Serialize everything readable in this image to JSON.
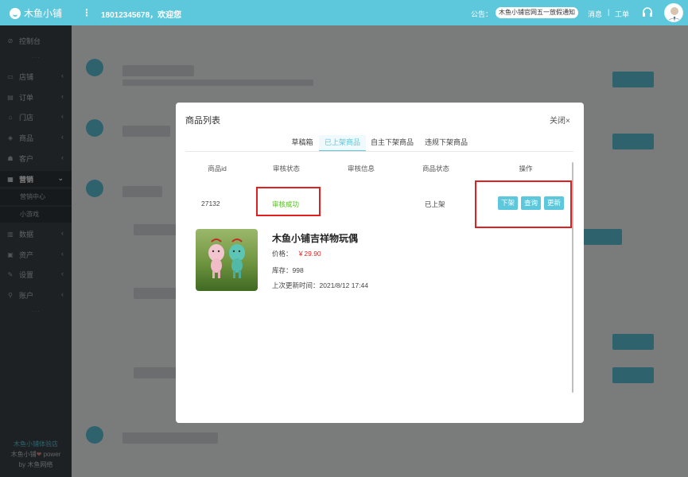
{
  "header": {
    "logo_text": "木鱼小铺",
    "more_icon": "⋮",
    "welcome": "18012345678，欢迎您",
    "notice_label": "公告：",
    "notice_text": "木鱼小铺官网五一放假通知",
    "messages": "消息",
    "separator": "|",
    "tickets": "工单",
    "colors": {
      "accent": "#5dc7dc"
    }
  },
  "sidebar": {
    "items": [
      {
        "label": "控制台",
        "icon": "dashboard-icon"
      },
      {
        "label": "店铺",
        "icon": "shop-icon"
      },
      {
        "label": "订单",
        "icon": "order-icon"
      },
      {
        "label": "门店",
        "icon": "store-icon"
      },
      {
        "label": "商品",
        "icon": "goods-icon"
      },
      {
        "label": "客户",
        "icon": "customer-icon"
      },
      {
        "label": "营销",
        "icon": "marketing-icon"
      },
      {
        "label": "数据",
        "icon": "data-icon"
      },
      {
        "label": "资产",
        "icon": "asset-icon"
      },
      {
        "label": "设置",
        "icon": "settings-icon"
      },
      {
        "label": "账户",
        "icon": "account-icon"
      }
    ],
    "sub_items": [
      "营销中心",
      "小游戏"
    ],
    "footer": {
      "shop_name": "木鱼小铺体验店",
      "power_prefix": "木鱼小铺",
      "power_suffix": "power",
      "by": "by 木鱼网络"
    }
  },
  "modal": {
    "title": "商品列表",
    "close_label": "关闭×",
    "tabs": [
      "草稿箱",
      "已上架商品",
      "自主下架商品",
      "违规下架商品"
    ],
    "active_tab": "已上架商品",
    "columns": [
      "商品id",
      "审核状态",
      "审核信息",
      "商品状态",
      "操作"
    ],
    "row": {
      "id": "27132",
      "audit_status": "审核成功",
      "audit_info": "",
      "product_status": "已上架",
      "actions": [
        "下架",
        "查询",
        "更新"
      ]
    },
    "product": {
      "name": "木鱼小铺吉祥物玩偶",
      "price_label": "价格：",
      "price": "￥29.90",
      "stock_label": "库存：",
      "stock": "998",
      "updated_label": "上次更新时间：",
      "updated": "2021/8/12 17:44"
    }
  }
}
